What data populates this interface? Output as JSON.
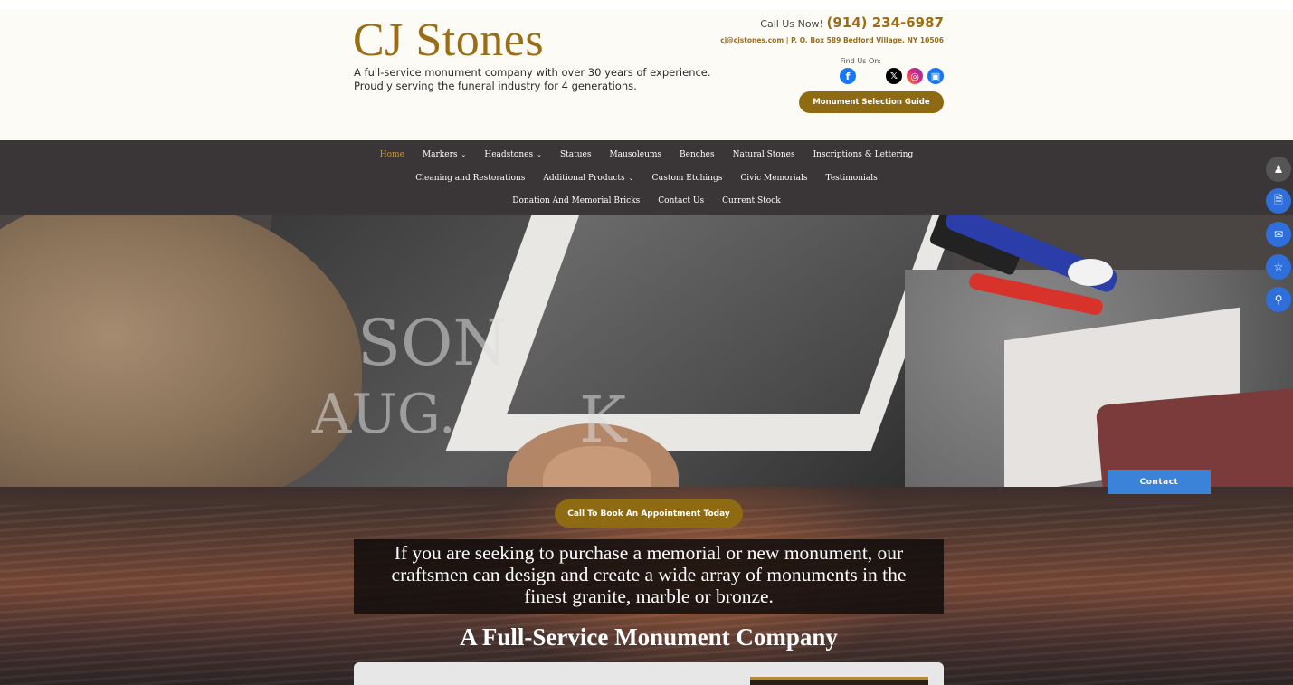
{
  "brand": {
    "logo": "CJ Stones",
    "tagline_line1": "A full-service monument company with over 30 years of experience.",
    "tagline_line2": "Proudly serving the funeral industry for 4 generations."
  },
  "header": {
    "call_label": "Call Us Now!",
    "phone": "(914) 234-6987",
    "contact_line": "cj@cjstones.com | P. O. Box 589 Bedford Village, NY 10506",
    "find_us": "Find Us On:",
    "guide_button": "Monument Selection Guide"
  },
  "social_icons": [
    "facebook-icon",
    "x-icon",
    "instagram-icon",
    "other-social-icon"
  ],
  "nav": {
    "row1": [
      {
        "label": "Home",
        "caret": false,
        "active": true
      },
      {
        "label": "Markers",
        "caret": true
      },
      {
        "label": "Headstones",
        "caret": true
      },
      {
        "label": "Statues",
        "caret": false
      },
      {
        "label": "Mausoleums",
        "caret": false
      },
      {
        "label": "Benches",
        "caret": false
      },
      {
        "label": "Natural Stones",
        "caret": false
      },
      {
        "label": "Inscriptions & Lettering",
        "caret": false
      }
    ],
    "row2": [
      {
        "label": "Cleaning and Restorations",
        "caret": false
      },
      {
        "label": "Additional Products",
        "caret": true
      },
      {
        "label": "Custom Etchings",
        "caret": false
      },
      {
        "label": "Civic Memorials",
        "caret": false
      },
      {
        "label": "Testimonials",
        "caret": false
      }
    ],
    "row3": [
      {
        "label": "Donation And Memorial Bricks",
        "caret": false
      },
      {
        "label": "Contact Us",
        "caret": false
      },
      {
        "label": "Current Stock",
        "caret": false
      }
    ]
  },
  "hero": {
    "stone_text_1": "SON",
    "stone_text_2": "AUG.",
    "stone_text_3": "K"
  },
  "main": {
    "appointment_button": "Call To Book An Appointment Today",
    "quote_line1": "If you are seeking to purchase a memorial or new monument, our",
    "quote_line2": "craftsmen can design and create a wide array of monuments in the",
    "quote_line3": "finest granite, marble or bronze.",
    "section_title": "A Full-Service Monument Company",
    "contact_button": "Contact"
  },
  "side_widget": [
    "user-icon",
    "document-icon",
    "mail-icon",
    "star-icon",
    "location-icon"
  ],
  "colors": {
    "brand_gold": "#9a6e16",
    "button_gold": "#8e6a12",
    "nav_bg": "#3a3536",
    "accent_blue": "#3b82d9"
  }
}
